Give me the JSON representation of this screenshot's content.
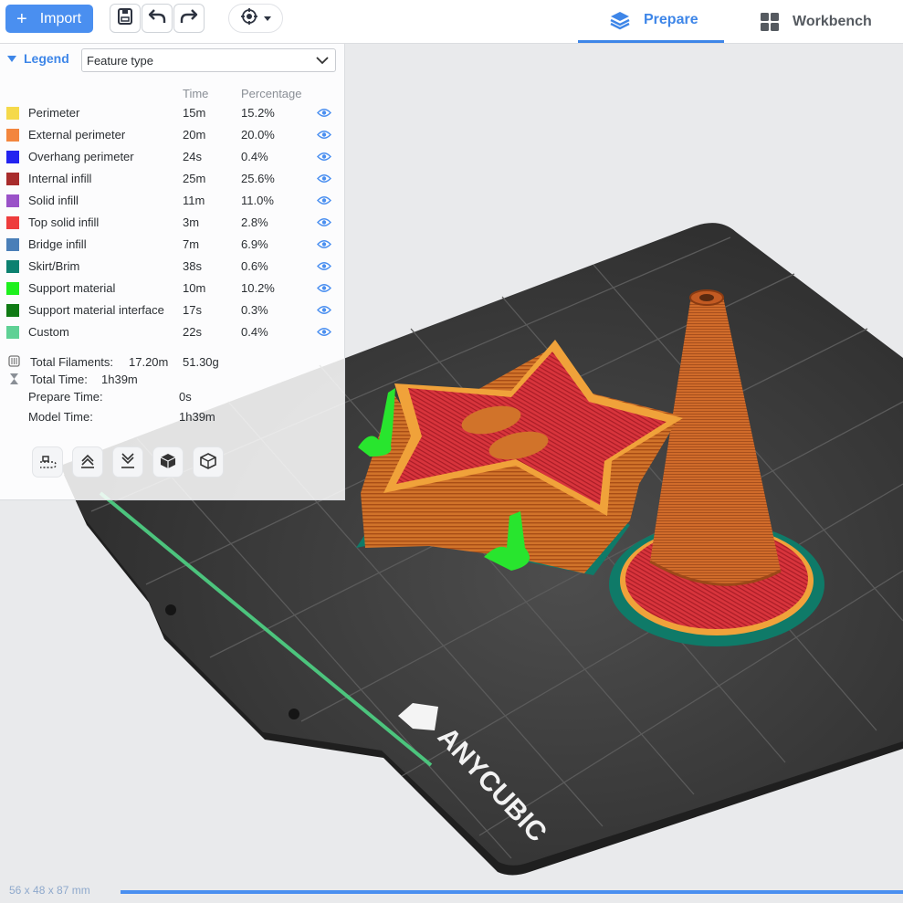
{
  "toolbar": {
    "import_label": "Import",
    "icons": [
      "save-icon",
      "undo-icon",
      "redo-icon",
      "view-target-icon"
    ]
  },
  "tabs": [
    {
      "label": "Prepare",
      "active": true
    },
    {
      "label": "Workbench",
      "active": false
    }
  ],
  "legend": {
    "title": "Legend",
    "view_type": "Feature type",
    "col_time": "Time",
    "col_percentage": "Percentage",
    "items": [
      {
        "name": "Perimeter",
        "time": "15m",
        "pct": "15.2%",
        "color": "#f5d94a"
      },
      {
        "name": "External perimeter",
        "time": "20m",
        "pct": "20.0%",
        "color": "#f3863e"
      },
      {
        "name": "Overhang perimeter",
        "time": "24s",
        "pct": "0.4%",
        "color": "#2323f0"
      },
      {
        "name": "Internal infill",
        "time": "25m",
        "pct": "25.6%",
        "color": "#a82c2c"
      },
      {
        "name": "Solid infill",
        "time": "11m",
        "pct": "11.0%",
        "color": "#9a52c8"
      },
      {
        "name": "Top solid infill",
        "time": "3m",
        "pct": "2.8%",
        "color": "#ee3d3d"
      },
      {
        "name": "Bridge infill",
        "time": "7m",
        "pct": "6.9%",
        "color": "#4a7fb8"
      },
      {
        "name": "Skirt/Brim",
        "time": "38s",
        "pct": "0.6%",
        "color": "#0c8170"
      },
      {
        "name": "Support material",
        "time": "10m",
        "pct": "10.2%",
        "color": "#1ef01e"
      },
      {
        "name": "Support material interface",
        "time": "17s",
        "pct": "0.3%",
        "color": "#0f7a14"
      },
      {
        "name": "Custom",
        "time": "22s",
        "pct": "0.4%",
        "color": "#5fd195"
      }
    ],
    "total_filaments_label": "Total Filaments:",
    "total_filaments_length": "17.20m",
    "total_filaments_weight": "51.30g",
    "total_time_label": "Total Time:",
    "total_time": "1h39m",
    "prepare_time_label": "Prepare Time:",
    "prepare_time": "0s",
    "model_time_label": "Model Time:",
    "model_time": "1h39m"
  },
  "bed": {
    "brand": "ANYCUBIC"
  },
  "status": {
    "dimensions": "56 x 48 x 87 mm"
  }
}
